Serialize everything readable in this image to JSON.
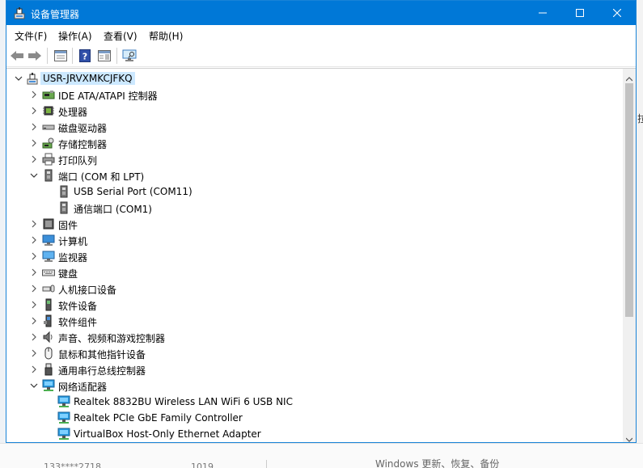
{
  "window": {
    "title": "设备管理器"
  },
  "menu": [
    "文件(F)",
    "操作(A)",
    "查看(V)",
    "帮助(H)"
  ],
  "toolbar": {
    "icons": [
      "back-arrow-icon",
      "forward-arrow-icon",
      "properties-view-icon",
      "help-icon",
      "action-pane-icon",
      "scan-monitor-icon"
    ]
  },
  "tree": {
    "root": "USR-JRVXMKCJFKQ",
    "items": [
      {
        "label": "IDE ATA/ATAPI 控制器",
        "icon": "ide-controller-icon",
        "expanded": false
      },
      {
        "label": "处理器",
        "icon": "processor-icon",
        "expanded": false
      },
      {
        "label": "磁盘驱动器",
        "icon": "disk-drive-icon",
        "expanded": false
      },
      {
        "label": "存储控制器",
        "icon": "storage-controller-icon",
        "expanded": false
      },
      {
        "label": "打印队列",
        "icon": "printer-icon",
        "expanded": false
      },
      {
        "label": "端口 (COM 和 LPT)",
        "icon": "port-icon",
        "expanded": true,
        "children": [
          "USB Serial Port (COM11)",
          "通信端口 (COM1)"
        ]
      },
      {
        "label": "固件",
        "icon": "firmware-icon",
        "expanded": false
      },
      {
        "label": "计算机",
        "icon": "computer-icon",
        "expanded": false
      },
      {
        "label": "监视器",
        "icon": "monitor-icon",
        "expanded": false
      },
      {
        "label": "键盘",
        "icon": "keyboard-icon",
        "expanded": false
      },
      {
        "label": "人机接口设备",
        "icon": "hid-icon",
        "expanded": false
      },
      {
        "label": "软件设备",
        "icon": "software-device-icon",
        "expanded": false
      },
      {
        "label": "软件组件",
        "icon": "software-component-icon",
        "expanded": false
      },
      {
        "label": "声音、视频和游戏控制器",
        "icon": "speaker-icon",
        "expanded": false
      },
      {
        "label": "鼠标和其他指针设备",
        "icon": "mouse-icon",
        "expanded": false
      },
      {
        "label": "通用串行总线控制器",
        "icon": "usb-icon",
        "expanded": false
      },
      {
        "label": "网络适配器",
        "icon": "network-adapter-icon",
        "expanded": true,
        "children": [
          "Realtek 8832BU Wireless LAN WiFi 6 USB NIC",
          "Realtek PCIe GbE Family Controller",
          "VirtualBox Host-Only Ethernet Adapter"
        ]
      }
    ]
  },
  "background": {
    "right_fragment": "拉",
    "bottom_left": "133****2718",
    "bottom_mid": "1019",
    "bottom_right": "Windows 更新、恢复、备份"
  },
  "colors": {
    "titlebar": "#0078d7",
    "selection": "#cce8ff",
    "scroll_thumb": "#c2c2c2"
  }
}
